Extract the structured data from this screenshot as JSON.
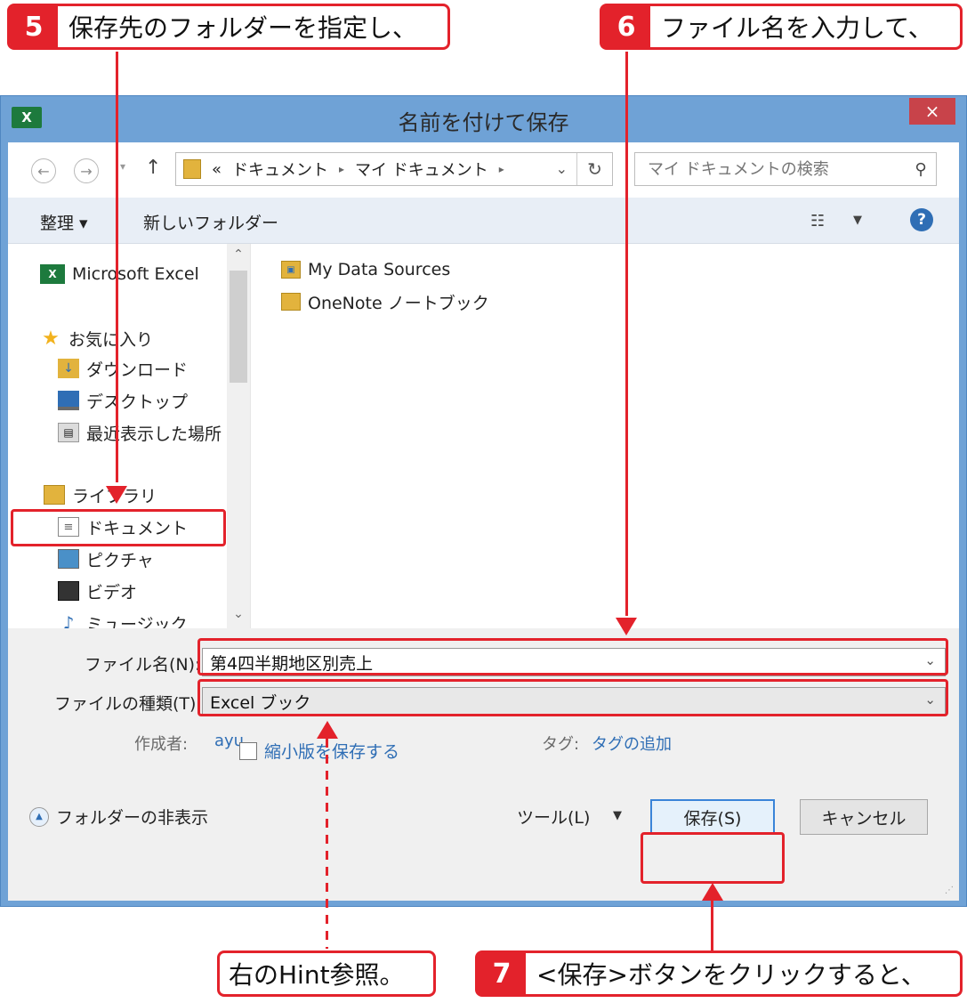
{
  "callouts": {
    "step5": {
      "num": "5",
      "text": "保存先のフォルダーを指定し、"
    },
    "step6": {
      "num": "6",
      "text": "ファイル名を入力して、"
    },
    "step7": {
      "num": "7",
      "text": "<保存>ボタンをクリックすると、"
    },
    "hint": {
      "text": "右のHint参照。"
    }
  },
  "window": {
    "title": "名前を付けて保存",
    "app_icon": "excel-icon",
    "close_glyph": "×"
  },
  "address_bar": {
    "prefix": "«",
    "path": [
      "ドキュメント",
      "マイ ドキュメント"
    ],
    "search_placeholder": "マイ ドキュメントの検索"
  },
  "toolbar": {
    "organize": "整理 ▾",
    "new_folder": "新しいフォルダー",
    "help": "?"
  },
  "nav_pane": {
    "items": [
      {
        "label": "Microsoft Excel",
        "icon": "excel-icon"
      },
      {
        "label": "お気に入り",
        "icon": "star-icon"
      },
      {
        "label": "ダウンロード",
        "icon": "download-folder-icon"
      },
      {
        "label": "デスクトップ",
        "icon": "desktop-icon"
      },
      {
        "label": "最近表示した場所",
        "icon": "recent-places-icon"
      },
      {
        "label": "ライブラリ",
        "icon": "library-icon"
      },
      {
        "label": "ドキュメント",
        "icon": "documents-icon"
      },
      {
        "label": "ピクチャ",
        "icon": "pictures-icon"
      },
      {
        "label": "ビデオ",
        "icon": "videos-icon"
      },
      {
        "label": "ミュージック",
        "icon": "music-icon"
      }
    ]
  },
  "files": [
    {
      "name": "My Data Sources",
      "icon": "data-sources-folder-icon"
    },
    {
      "name": "OneNote ノートブック",
      "icon": "folder-icon"
    }
  ],
  "form": {
    "filename_label": "ファイル名(N):",
    "filename_value": "第4四半期地区別売上",
    "filetype_label": "ファイルの種類(T):",
    "filetype_value": "Excel ブック",
    "author_label": "作成者:",
    "author_value": "ayu",
    "tags_label": "タグ:",
    "tags_value": "タグの追加",
    "thumbnail_label": "縮小版を保存する",
    "thumbnail_checked": false,
    "hide_folders": "フォルダーの非表示",
    "tools": "ツール(L)",
    "save": "保存(S)",
    "cancel": "キャンセル"
  },
  "colors": {
    "accent_red": "#e3222b",
    "window_frame": "#6fa2d6",
    "link_blue": "#2f6eb5"
  }
}
